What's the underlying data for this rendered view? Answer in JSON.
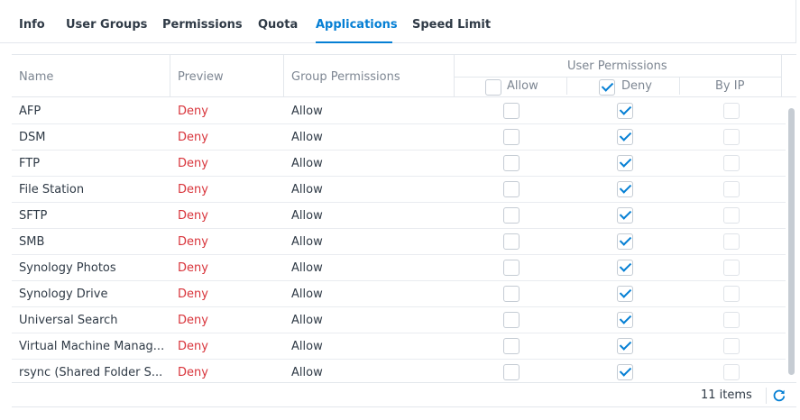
{
  "tabs": [
    {
      "label": "Info"
    },
    {
      "label": "User Groups"
    },
    {
      "label": "Permissions"
    },
    {
      "label": "Quota"
    },
    {
      "label": "Applications"
    },
    {
      "label": "Speed Limit"
    }
  ],
  "active_tab": "Applications",
  "table": {
    "columns": {
      "name": "Name",
      "preview": "Preview",
      "group_permissions": "Group Permissions",
      "user_permissions": "User Permissions",
      "allow": "Allow",
      "deny": "Deny",
      "by_ip": "By IP"
    },
    "header_checks": {
      "allow": false,
      "deny": true
    },
    "rows": [
      {
        "name": "AFP",
        "preview": "Deny",
        "group": "Allow",
        "allow": false,
        "deny": true,
        "by_ip": false
      },
      {
        "name": "DSM",
        "preview": "Deny",
        "group": "Allow",
        "allow": false,
        "deny": true,
        "by_ip": false
      },
      {
        "name": "FTP",
        "preview": "Deny",
        "group": "Allow",
        "allow": false,
        "deny": true,
        "by_ip": false
      },
      {
        "name": "File Station",
        "preview": "Deny",
        "group": "Allow",
        "allow": false,
        "deny": true,
        "by_ip": false
      },
      {
        "name": "SFTP",
        "preview": "Deny",
        "group": "Allow",
        "allow": false,
        "deny": true,
        "by_ip": false
      },
      {
        "name": "SMB",
        "preview": "Deny",
        "group": "Allow",
        "allow": false,
        "deny": true,
        "by_ip": false
      },
      {
        "name": "Synology Photos",
        "preview": "Deny",
        "group": "Allow",
        "allow": false,
        "deny": true,
        "by_ip": false
      },
      {
        "name": "Synology Drive",
        "preview": "Deny",
        "group": "Allow",
        "allow": false,
        "deny": true,
        "by_ip": false
      },
      {
        "name": "Universal Search",
        "preview": "Deny",
        "group": "Allow",
        "allow": false,
        "deny": true,
        "by_ip": false
      },
      {
        "name": "Virtual Machine Manag...",
        "preview": "Deny",
        "group": "Allow",
        "allow": false,
        "deny": true,
        "by_ip": false
      },
      {
        "name": "rsync (Shared Folder S...",
        "preview": "Deny",
        "group": "Allow",
        "allow": false,
        "deny": true,
        "by_ip": false
      }
    ]
  },
  "footer": {
    "count_label": "11 items",
    "refresh_icon": "refresh-icon"
  },
  "colors": {
    "accent": "#057fd4",
    "deny_text": "#d8333a"
  }
}
